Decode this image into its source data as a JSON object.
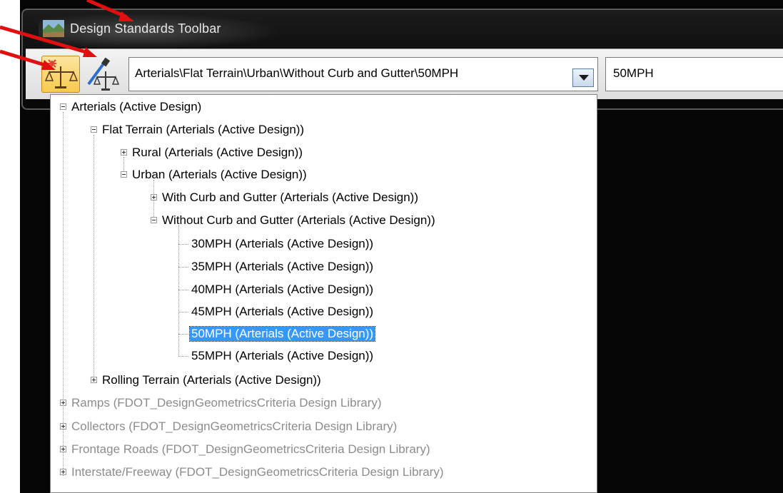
{
  "window": {
    "title": "Design Standards Toolbar"
  },
  "toolbar": {
    "combo_value": "Arterials\\Flat Terrain\\Urban\\Without Curb and Gutter\\50MPH",
    "value_box": "50MPH"
  },
  "tree": [
    {
      "label": "Arterials (Active Design)",
      "style": "normal"
    },
    {
      "label": "Flat Terrain (Arterials (Active Design))",
      "style": "normal"
    },
    {
      "label": "Rural (Arterials (Active Design))",
      "style": "normal"
    },
    {
      "label": "Urban (Arterials (Active Design))",
      "style": "normal"
    },
    {
      "label": "With Curb and Gutter (Arterials (Active Design))",
      "style": "normal"
    },
    {
      "label": "Without Curb and Gutter (Arterials (Active Design))",
      "style": "normal"
    },
    {
      "label": "30MPH (Arterials (Active Design))",
      "style": "normal"
    },
    {
      "label": "35MPH (Arterials (Active Design))",
      "style": "normal"
    },
    {
      "label": "40MPH (Arterials (Active Design))",
      "style": "normal"
    },
    {
      "label": "45MPH (Arterials (Active Design))",
      "style": "normal"
    },
    {
      "label": "50MPH (Arterials (Active Design))",
      "style": "selected"
    },
    {
      "label": "55MPH (Arterials (Active Design))",
      "style": "normal"
    },
    {
      "label": "Rolling Terrain (Arterials (Active Design))",
      "style": "normal"
    },
    {
      "label": "Ramps (FDOT_DesignGeometricsCriteria Design Library)",
      "style": "gray"
    },
    {
      "label": "Collectors (FDOT_DesignGeometricsCriteria Design Library)",
      "style": "gray"
    },
    {
      "label": "Frontage Roads (FDOT_DesignGeometricsCriteria Design Library)",
      "style": "gray"
    },
    {
      "label": "Interstate/Freeway (FDOT_DesignGeometricsCriteria Design Library)",
      "style": "gray"
    }
  ],
  "colors": {
    "selection": "#3399ff",
    "annotation_arrow": "#e01010",
    "active_button": "#f7c94d"
  }
}
